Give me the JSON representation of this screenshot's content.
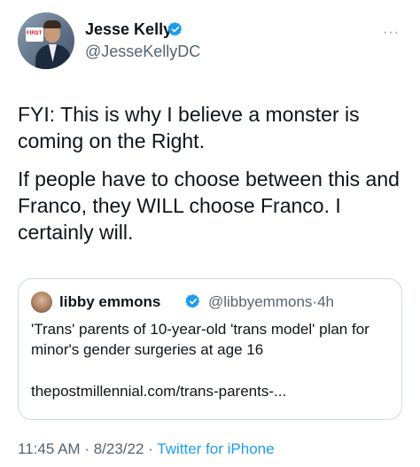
{
  "author": {
    "name": "Jesse Kelly",
    "handle": "@JesseKellyDC",
    "avatar_logo_text": "FIRST"
  },
  "tweet": {
    "paragraphs": [
      "FYI: This is why I believe a monster is coming on the Right.",
      "If people have to choose between this and Franco, they WILL choose Franco. I certainly will."
    ]
  },
  "quoted_tweet": {
    "name": "libby emmons",
    "handle": "@libbyemmons",
    "separator": "·",
    "time": "4h",
    "text": "'Trans' parents of 10-year-old 'trans model' plan for minor's gender surgeries at age 16",
    "link": "thepostmillennial.com/trans-parents-..."
  },
  "meta": {
    "time": "11:45 AM",
    "separator": "·",
    "date": "8/23/22",
    "source": "Twitter for iPhone"
  },
  "icons": {
    "verified": "verified-badge-icon",
    "more": "more-options-icon"
  },
  "colors": {
    "accent": "#1d9bf0",
    "text": "#0f1419",
    "secondary": "#536471",
    "border": "#cfd9de"
  }
}
